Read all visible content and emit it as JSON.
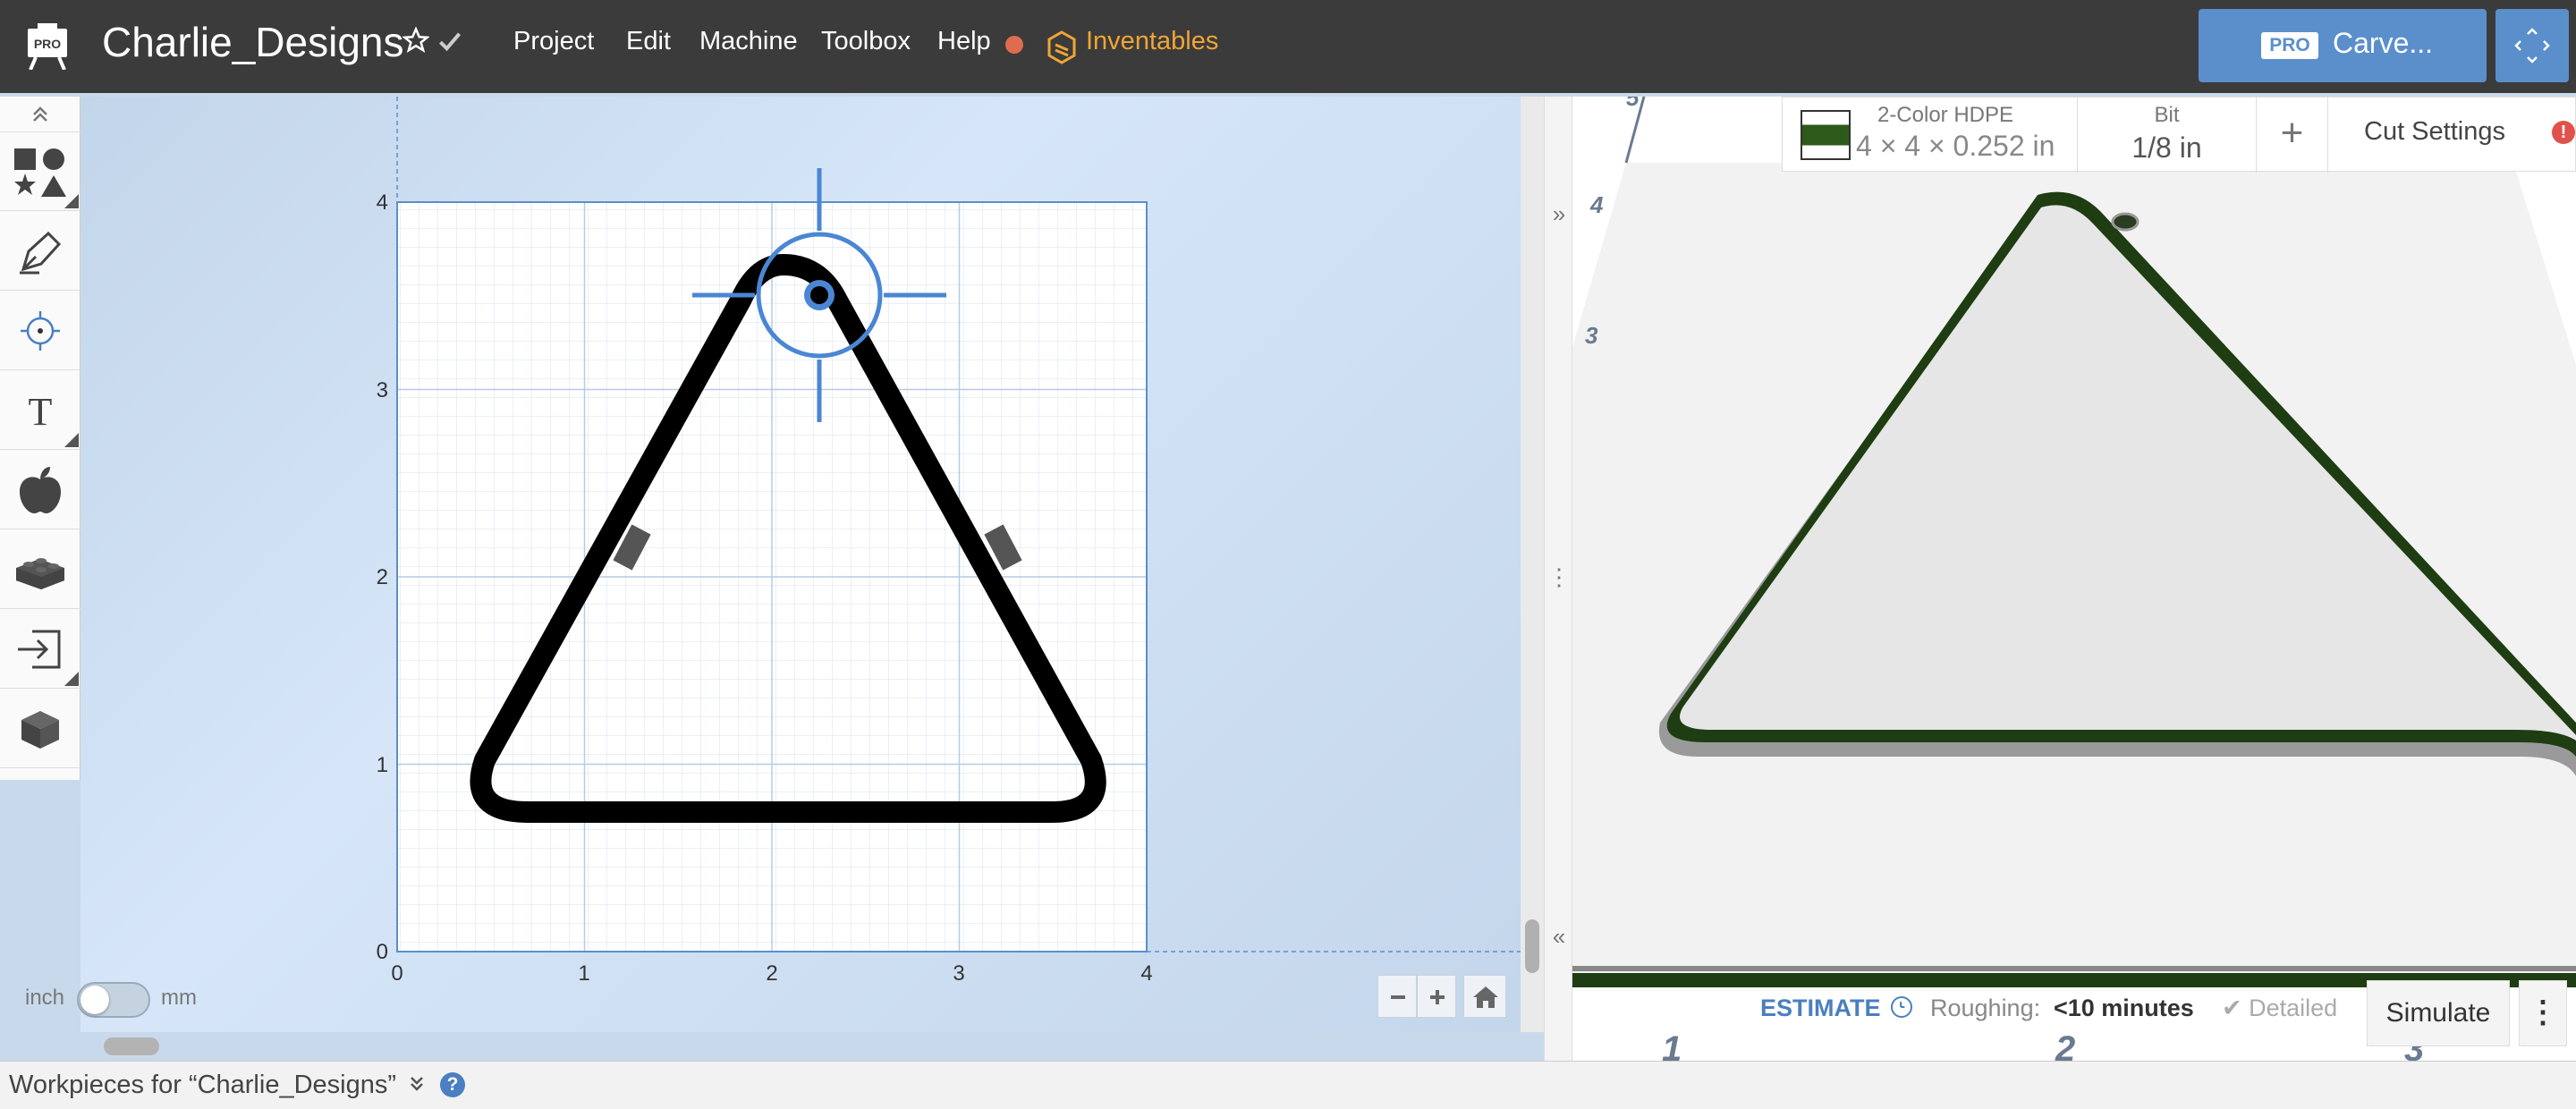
{
  "app": {
    "project_title": "Charlie_Designs",
    "logo_text": "PRO"
  },
  "menu": {
    "items": [
      "Project",
      "Edit",
      "Machine",
      "Toolbox",
      "Help"
    ],
    "inventables": "Inventables"
  },
  "carve": {
    "badge": "PRO",
    "label": "Carve..."
  },
  "tools": [
    "shapes-icon",
    "pen-icon",
    "point-icon",
    "text-icon",
    "apple-icon",
    "lego-icon",
    "import-icon",
    "cube-icon"
  ],
  "canvas": {
    "x_ticks": [
      "0",
      "1",
      "2",
      "3",
      "4"
    ],
    "y_ticks": [
      "0",
      "1",
      "2",
      "3",
      "4"
    ],
    "unit_left": "inch",
    "unit_right": "mm"
  },
  "preview": {
    "ruler_marks": [
      "5",
      "4",
      "3",
      "1",
      "2",
      "3"
    ]
  },
  "material": {
    "name": "2-Color HDPE",
    "size": "4 × 4 × 0.252 in",
    "bit_label": "Bit",
    "bit_size": "1/8 in",
    "add_label": "+",
    "cut_settings": "Cut Settings",
    "alert": "!"
  },
  "estimate": {
    "label": "ESTIMATE",
    "roughing_label": "Roughing:",
    "roughing_value": "<10 minutes",
    "detailed": "✔ Detailed",
    "simulate": "Simulate",
    "more": "⋮"
  },
  "bottom": {
    "workpieces": "Workpieces for “Charlie_Designs”",
    "help": "?"
  },
  "colors": {
    "topbar": "#3b3b3b",
    "accent": "#5a8fcc",
    "inventables": "#f0a535",
    "status_dot": "#e06c4f",
    "material_green": "#2d5a1b"
  }
}
